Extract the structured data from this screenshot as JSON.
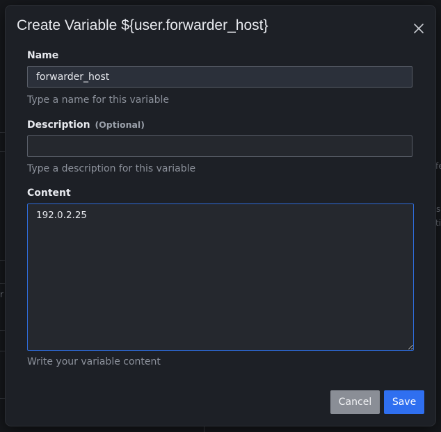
{
  "dialog": {
    "title": "Create Variable ${user.forwarder_host}",
    "close_icon": "close-icon"
  },
  "form": {
    "name": {
      "label": "Name",
      "value": "forwarder_host",
      "helper": "Type a name for this variable"
    },
    "description": {
      "label": "Description",
      "optional": "(Optional)",
      "value": "",
      "helper": "Type a description for this variable"
    },
    "content": {
      "label": "Content",
      "value": "192.0.2.25",
      "helper": "Write your variable content"
    }
  },
  "actions": {
    "cancel_label": "Cancel",
    "save_label": "Save"
  },
  "background": {
    "snippet_1": "fe",
    "snippet_2": "s",
    "snippet_3": "ti",
    "snippet_4": "r"
  },
  "colors": {
    "accent": "#2f6ff0",
    "cancel": "#8a8e96",
    "modal_bg": "#1d2026",
    "focus_border": "#2e6bd9"
  }
}
